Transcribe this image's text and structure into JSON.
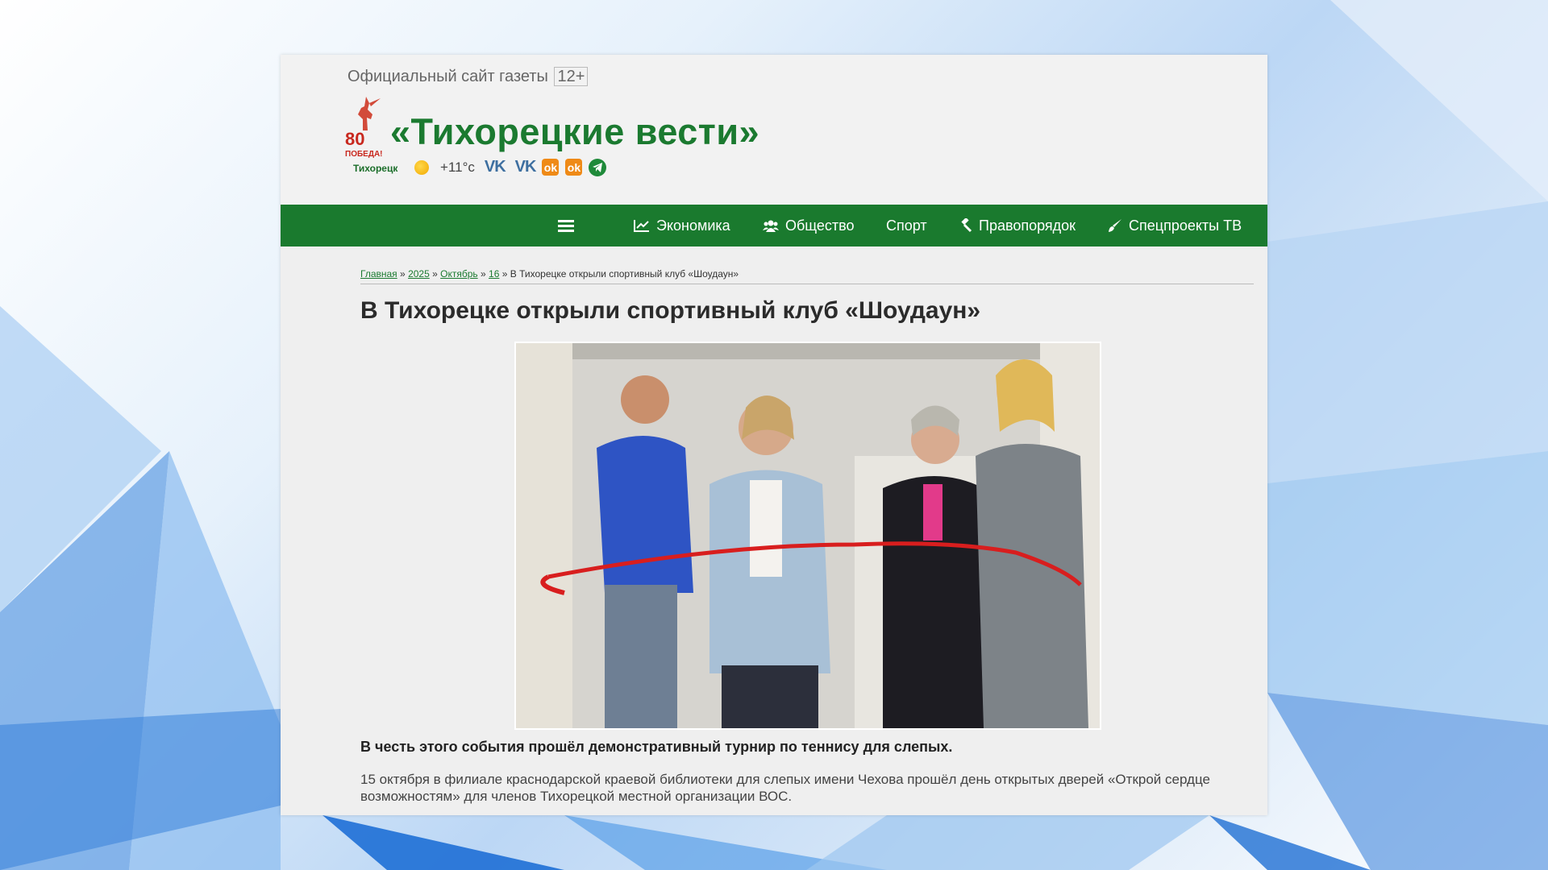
{
  "header": {
    "official_label": "Официальный сайт газеты",
    "age_rating": "12+",
    "logo_badge": "80 ПОБЕДА!",
    "city": "Тихорецк",
    "site_title": "«Тихорецкие вести»",
    "weather_icon": "sun-icon",
    "temperature": "+11°c",
    "social": [
      "vk-icon",
      "vk-icon",
      "ok-icon",
      "ok-icon",
      "telegram-icon"
    ]
  },
  "nav": {
    "menu_icon": "hamburger-icon",
    "items": [
      {
        "label": "Экономика",
        "icon": "chart-icon"
      },
      {
        "label": "Общество",
        "icon": "users-icon"
      },
      {
        "label": "Спорт",
        "icon": ""
      },
      {
        "label": "Правопорядок",
        "icon": "gavel-icon"
      },
      {
        "label": "Спецпроекты ТВ",
        "icon": "brush-icon"
      }
    ],
    "background": "#1a7a2e"
  },
  "breadcrumb": {
    "items": [
      "Главная",
      "2025",
      "Октябрь",
      "16"
    ],
    "current": "В Тихорецке открыли спортивный клуб «Шоудаун»",
    "separator": "»"
  },
  "article": {
    "title": "В Тихорецке открыли спортивный клуб «Шоудаун»",
    "lead": "В честь этого события прошёл демонстративный турнир по теннису для слепых.",
    "body": "15 октября в филиале краснодарской краевой библиотеки для слепых имени Чехова прошёл день открытых дверей «Открой сердце возможностям» для членов Тихорецкой местной организации ВОС."
  },
  "colors": {
    "brand_green": "#1b7a30",
    "page_bg": "#efefef"
  }
}
